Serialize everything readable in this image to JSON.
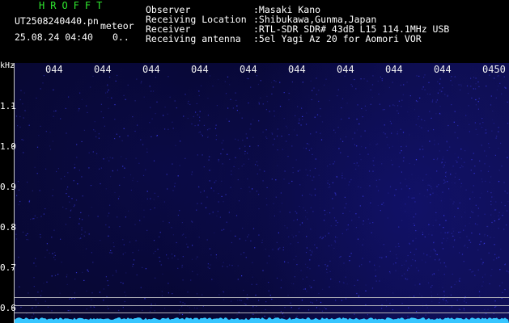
{
  "header": {
    "brand": "HROFFT",
    "filename": "UT2508240440.pn",
    "mode": "meteor",
    "timestamp": "25.08.24 04:40",
    "count": "0..",
    "observer_label": "Observer",
    "observer_value": ":Masaki Kano",
    "location_label": "Receiving Location",
    "location_value": ":Shibukawa,Gunma,Japan",
    "receiver_label": "Receiver",
    "receiver_value": ":RTL-SDR SDR# 43dB L15 114.1MHz USB",
    "antenna_label": "Receiving antenna",
    "antenna_value": ":5el Yagi Az 20 for Aomori VOR"
  },
  "y_axis": {
    "unit": "kHz",
    "ticks": [
      "1.1",
      "1.0",
      "0.9",
      "0.8",
      "0.7",
      "0.6"
    ]
  },
  "x_axis": {
    "ticks": [
      "044",
      "044",
      "044",
      "044",
      "044",
      "044",
      "044",
      "044",
      "044",
      "0450"
    ]
  },
  "colors": {
    "brand": "#2ee62e",
    "background": "#000000",
    "spectrogram_dark": "#05052a",
    "spectrogram_noise": "#3030d0",
    "baseline": "#36c6ff"
  }
}
